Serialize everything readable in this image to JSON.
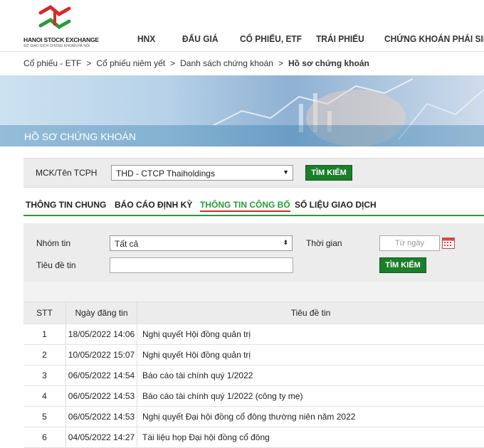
{
  "header": {
    "logo_name": "HANOI STOCK EXCHANGE",
    "logo_sub": "SỞ GIAO DỊCH CHỨNG KHOÁN HÀ NỘI",
    "nav": [
      "HNX",
      "ĐẤU GIÁ",
      "CỔ PHIẾU, ETF",
      "TRÁI PHIẾU",
      "CHỨNG KHOÁN PHÁI SINH"
    ]
  },
  "breadcrumb": [
    "Cổ phiếu - ETF",
    "Cổ phiếu niêm yết",
    "Danh sách chứng khoán",
    "Hồ sơ chứng khoán"
  ],
  "banner": {
    "title": "Hồ sơ chứng khoán"
  },
  "search": {
    "label": "MCK/Tên TCPH",
    "selected": "THD - CTCP Thaiholdings",
    "button": "TÌM KIẾM"
  },
  "tabs": [
    "THÔNG TIN CHUNG",
    "BÁO CÁO ĐỊNH KỲ",
    "THÔNG TIN CÔNG BỐ",
    "SỐ LIỆU GIAO DỊCH"
  ],
  "filter": {
    "group_label": "Nhóm tin",
    "group_value": "Tất cả",
    "time_label": "Thời gian",
    "from_placeholder": "Từ ngày",
    "title_label": "Tiêu đề tin",
    "button": "TÌM KIẾM"
  },
  "table": {
    "headers": [
      "STT",
      "Ngày đăng tin",
      "Tiêu đề tin"
    ],
    "rows": [
      [
        "1",
        "18/05/2022 14:06",
        "Nghị quyết Hội đồng quản trị"
      ],
      [
        "2",
        "10/05/2022 15:07",
        "Nghị quyết Hội đồng quản trị"
      ],
      [
        "3",
        "06/05/2022 14:54",
        "Báo cáo tài chính quý 1/2022"
      ],
      [
        "4",
        "06/05/2022 14:53",
        "Báo cáo tài chính quý 1/2022 (công ty mẹ)"
      ],
      [
        "5",
        "06/05/2022 14:53",
        "Nghị quyết Đại hội đồng cổ đông thường niên năm 2022"
      ],
      [
        "6",
        "04/05/2022 14:27",
        "Tài liệu họp Đại hội đồng cổ đông"
      ]
    ]
  },
  "colors": {
    "accent": "#1c7e2a",
    "tab_active": "#2a9a3a",
    "underline": "#d62a2a"
  }
}
